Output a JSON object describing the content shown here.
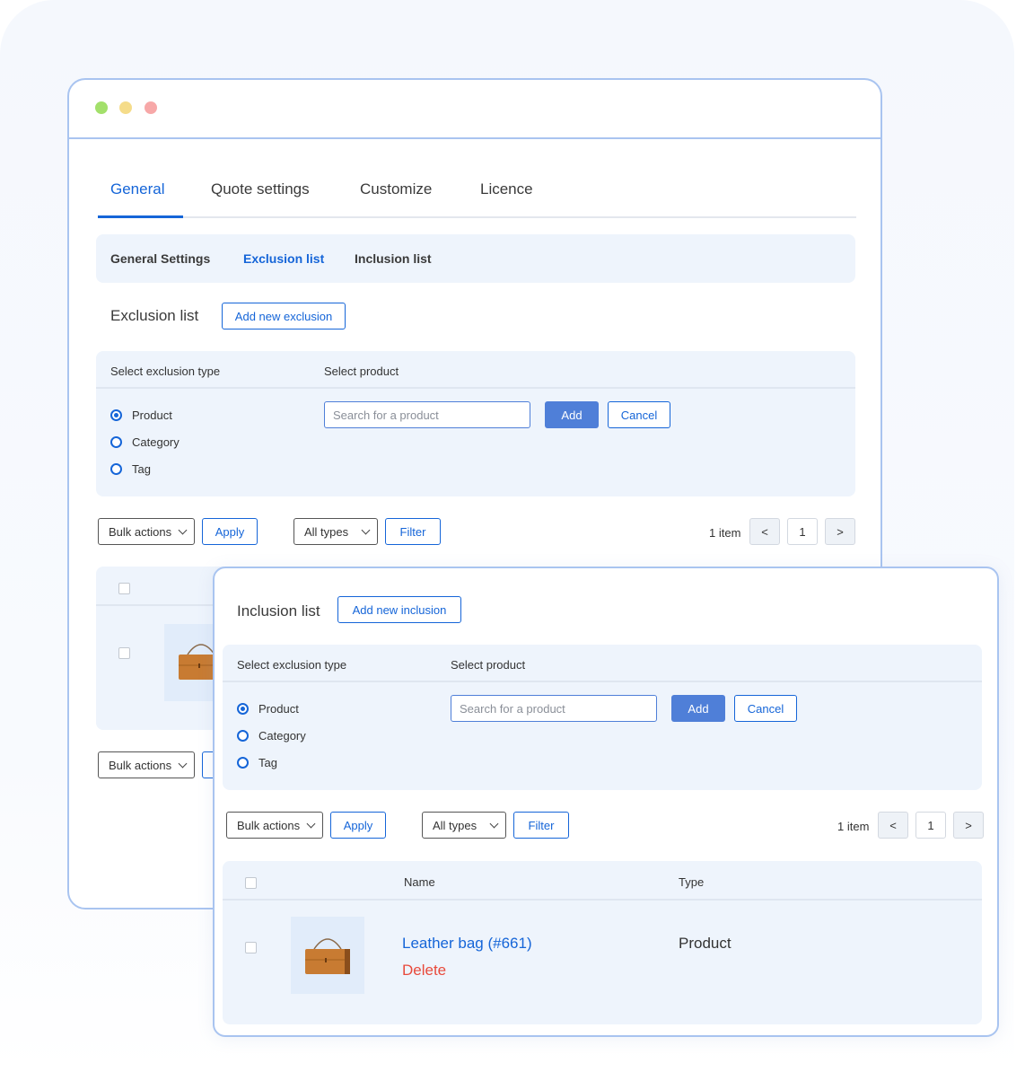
{
  "window": {
    "tabs": [
      {
        "label": "General"
      },
      {
        "label": "Quote settings"
      },
      {
        "label": "Customize"
      },
      {
        "label": "Licence"
      }
    ],
    "subtabs": [
      {
        "label": "General Settings"
      },
      {
        "label": "Exclusion list"
      },
      {
        "label": "Inclusion list"
      }
    ]
  },
  "exclusion": {
    "title": "Exclusion list",
    "add_new_label": "Add new exclusion",
    "type_label": "Select exclusion type",
    "product_label": "Select product",
    "types": [
      "Product",
      "Category",
      "Tag"
    ],
    "selected_type": "Product",
    "search_placeholder": "Search for a product",
    "add_label": "Add",
    "cancel_label": "Cancel",
    "bulk_actions": "Bulk actions",
    "apply_label": "Apply",
    "all_types": "All types",
    "filter_label": "Filter",
    "item_count": "1 item",
    "page_prev": "<",
    "page_current": "1",
    "page_next": ">",
    "bottom_bulk_actions": "Bulk actions"
  },
  "inclusion": {
    "title": "Inclusion list",
    "add_new_label": "Add new inclusion",
    "type_label": "Select exclusion type",
    "product_label": "Select product",
    "types": [
      "Product",
      "Category",
      "Tag"
    ],
    "selected_type": "Product",
    "search_placeholder": "Search for a product",
    "add_label": "Add",
    "cancel_label": "Cancel",
    "bulk_actions": "Bulk actions",
    "apply_label": "Apply",
    "all_types": "All types",
    "filter_label": "Filter",
    "item_count": "1 item",
    "page_prev": "<",
    "page_current": "1",
    "page_next": ">",
    "table": {
      "col_name": "Name",
      "col_type": "Type",
      "rows": [
        {
          "name": "Leather bag (#661)",
          "action": "Delete",
          "type": "Product",
          "thumb_icon": "leather-bag-icon"
        }
      ]
    }
  },
  "colors": {
    "accent": "#1565d8",
    "button_fill": "#4f7fd8",
    "panel_bg": "#eef4fc",
    "border": "#a9c4f0",
    "delete": "#e84a3c",
    "dot_green": "#a3e06b",
    "dot_yellow": "#f5dc8a",
    "dot_red": "#f7a8a8"
  }
}
